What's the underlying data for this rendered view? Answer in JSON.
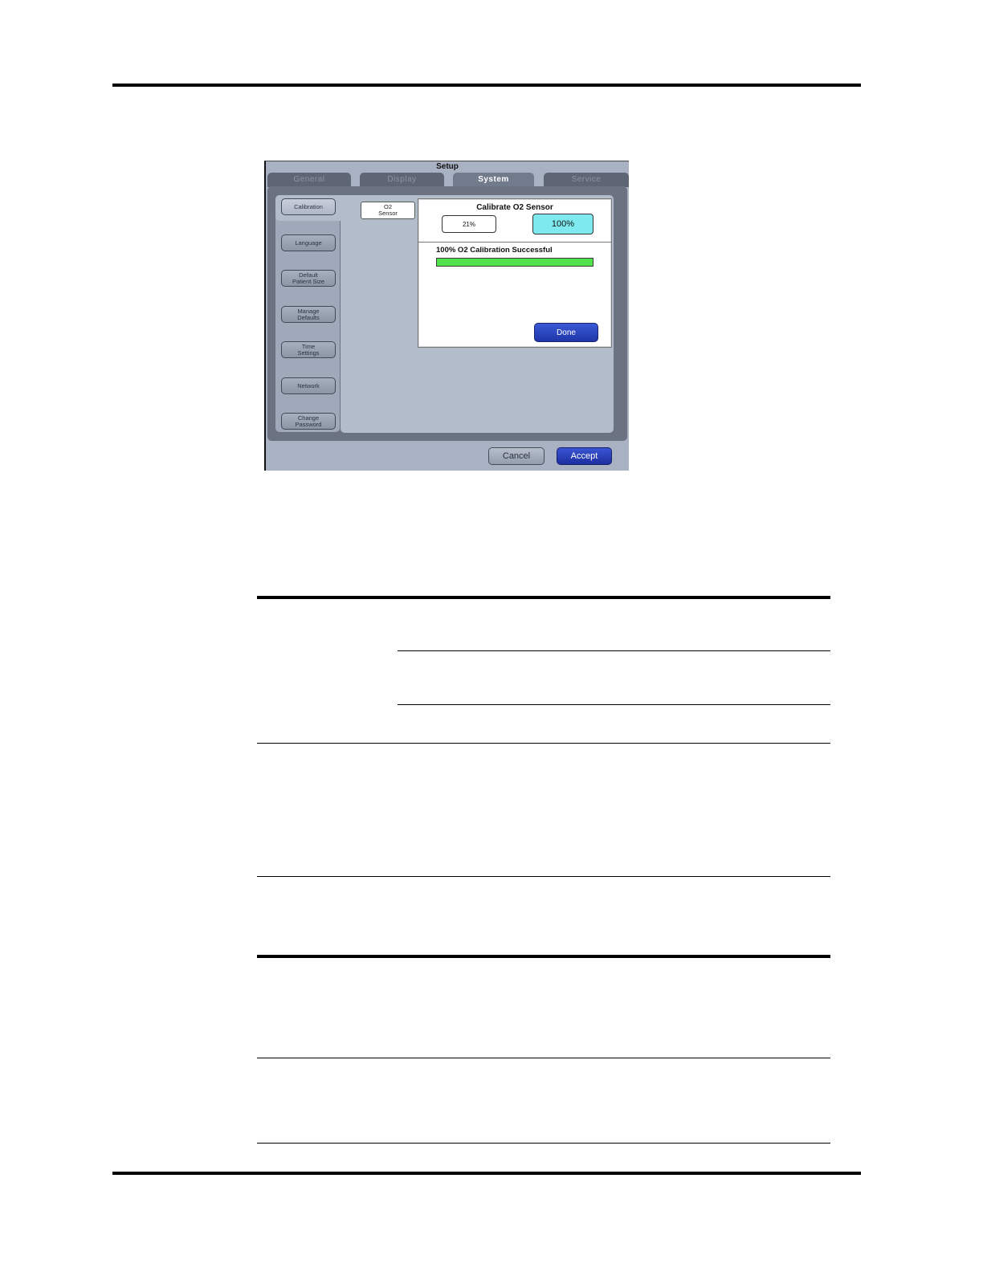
{
  "screen": {
    "title": "Setup",
    "tabs": [
      {
        "label": "General",
        "active": false
      },
      {
        "label": "Display",
        "active": false
      },
      {
        "label": "System",
        "active": true
      },
      {
        "label": "Service",
        "active": false
      }
    ],
    "sidebar": {
      "items": [
        {
          "label": "Calibration",
          "selected": true
        },
        {
          "label": "Language",
          "selected": false
        },
        {
          "label": "Default\nPatient Size",
          "selected": false
        },
        {
          "label": "Manage\nDefaults",
          "selected": false
        },
        {
          "label": "Time\nSettings",
          "selected": false
        },
        {
          "label": "Network",
          "selected": false
        },
        {
          "label": "Change\nPassword",
          "selected": false
        }
      ]
    },
    "sub_button": "O2\nSensor",
    "dialog": {
      "title": "Calibrate O2 Sensor",
      "option_21": "21%",
      "option_100": "100%",
      "status": "100% O2 Calibration Successful",
      "progress_percent": 100,
      "done_label": "Done"
    },
    "footer": {
      "cancel_label": "Cancel",
      "accept_label": "Accept"
    },
    "colors": {
      "selected_option": "#7eeaf0",
      "progress": "#4fe24a",
      "primary_button": "#1f36a8"
    }
  }
}
